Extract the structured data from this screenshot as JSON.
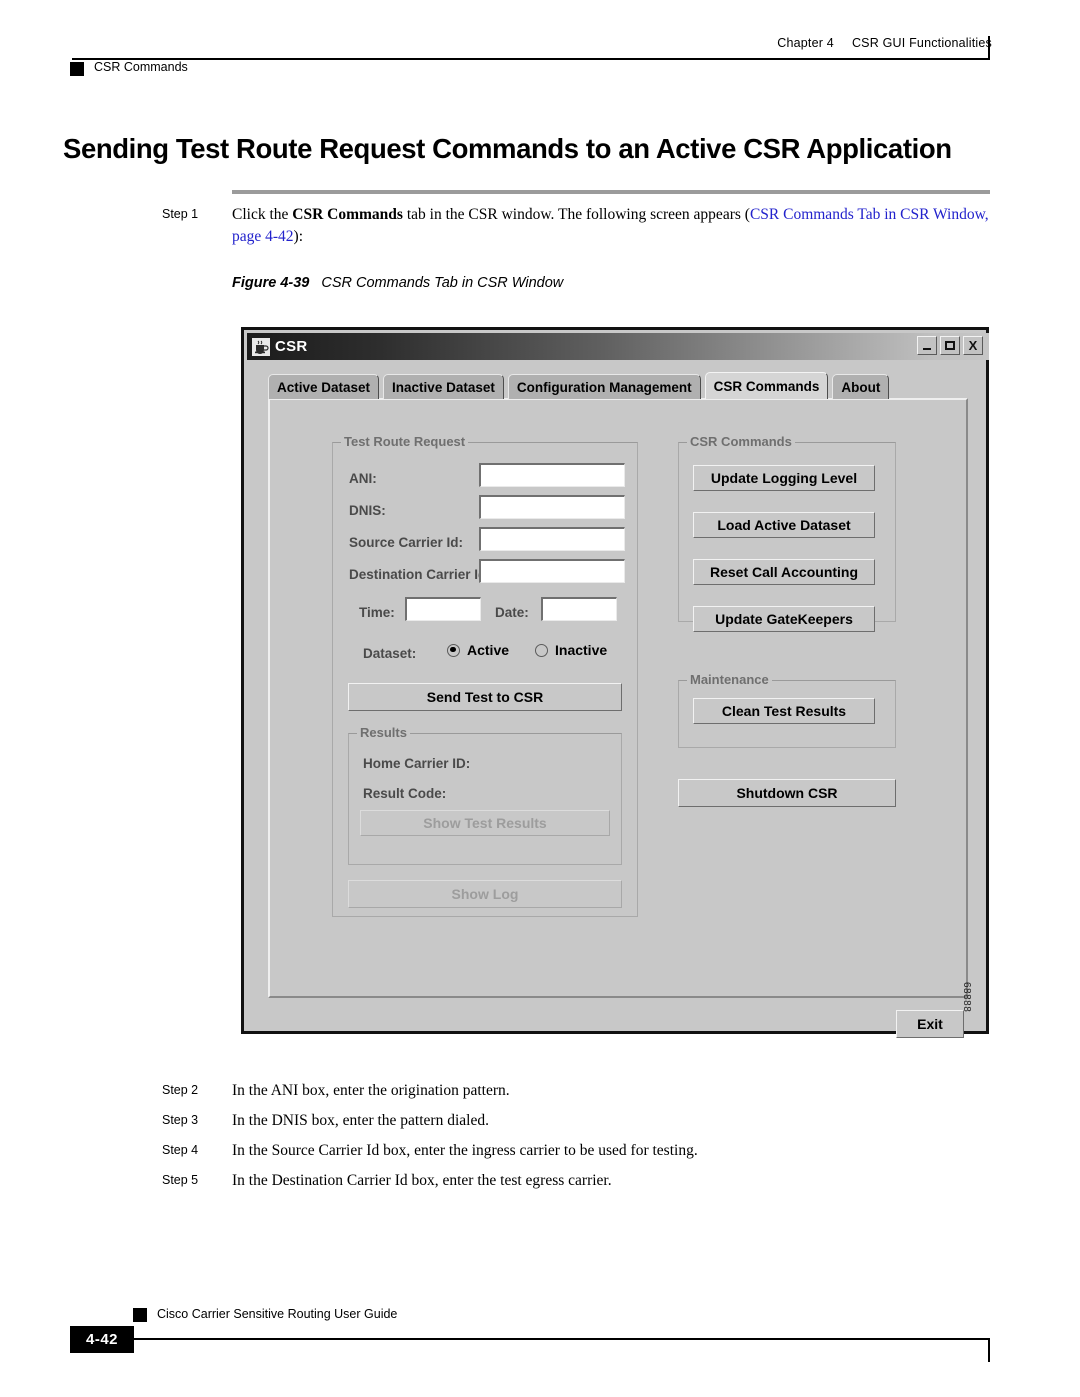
{
  "header": {
    "chapter": "Chapter 4",
    "chapter_title": "CSR GUI Functionalities",
    "running_head": "CSR Commands"
  },
  "heading": "Sending Test Route Request Commands to an Active CSR Application",
  "steps": [
    {
      "label": "Step 1",
      "segments": [
        {
          "text": "Click the ",
          "style": "normal"
        },
        {
          "text": "CSR Commands",
          "style": "bold"
        },
        {
          "text": " tab in the CSR window. The following screen appears (",
          "style": "normal"
        },
        {
          "text": "CSR Commands Tab in CSR Window, page 4-42",
          "style": "xref"
        },
        {
          "text": "):",
          "style": "normal"
        }
      ]
    },
    {
      "label": "Step 2",
      "text": "In the ANI box, enter the origination pattern."
    },
    {
      "label": "Step 3",
      "text": "In the DNIS box, enter the pattern dialed."
    },
    {
      "label": "Step 4",
      "text": "In the Source Carrier Id box, enter the ingress carrier to be used for testing."
    },
    {
      "label": "Step 5",
      "text": "In the Destination Carrier Id box, enter the test egress carrier."
    }
  ],
  "figure": {
    "number": "Figure 4-39",
    "title": "CSR Commands Tab in CSR Window",
    "doc_id": "68888"
  },
  "csr_window": {
    "title": "CSR",
    "icon": "java-coffee-cup-icon",
    "window_buttons": {
      "minimize": "minimize-icon",
      "maximize": "maximize-icon",
      "close": "X"
    },
    "tabs": [
      {
        "label": "Active Dataset",
        "selected": false
      },
      {
        "label": "Inactive Dataset",
        "selected": false
      },
      {
        "label": "Configuration Management",
        "selected": false
      },
      {
        "label": "CSR Commands",
        "selected": true
      },
      {
        "label": "About",
        "selected": false
      }
    ],
    "test_route_request": {
      "group_title": "Test Route Request",
      "fields": [
        {
          "label": "ANI:",
          "value": "",
          "placeholder": ""
        },
        {
          "label": "DNIS:",
          "value": "",
          "placeholder": ""
        },
        {
          "label": "Source Carrier Id:",
          "value": "",
          "placeholder": ""
        },
        {
          "label": "Destination Carrier Id:",
          "value": "",
          "placeholder": ""
        }
      ],
      "time_label": "Time:",
      "time_value": "",
      "date_label": "Date:",
      "date_value": "",
      "dataset_label": "Dataset:",
      "dataset_options": [
        {
          "label": "Active",
          "selected": true
        },
        {
          "label": "Inactive",
          "selected": false
        }
      ],
      "send_button": "Send Test to CSR"
    },
    "results": {
      "group_title": "Results",
      "home_carrier_label": "Home Carrier ID:",
      "home_carrier_value": "",
      "result_code_label": "Result Code:",
      "result_code_value": "",
      "show_test_results_button": "Show Test Results",
      "show_test_results_enabled": false
    },
    "show_log_button": "Show Log",
    "show_log_enabled": false,
    "csr_commands": {
      "group_title": "CSR Commands",
      "buttons": [
        "Update Logging Level",
        "Load Active Dataset",
        "Reset Call Accounting",
        "Update GateKeepers"
      ]
    },
    "maintenance": {
      "group_title": "Maintenance",
      "buttons": [
        "Clean Test Results"
      ]
    },
    "shutdown_button": "Shutdown CSR",
    "exit_button": "Exit"
  },
  "footer": {
    "guide_title": "Cisco Carrier Sensitive Routing User Guide",
    "page_number": "4-42"
  }
}
